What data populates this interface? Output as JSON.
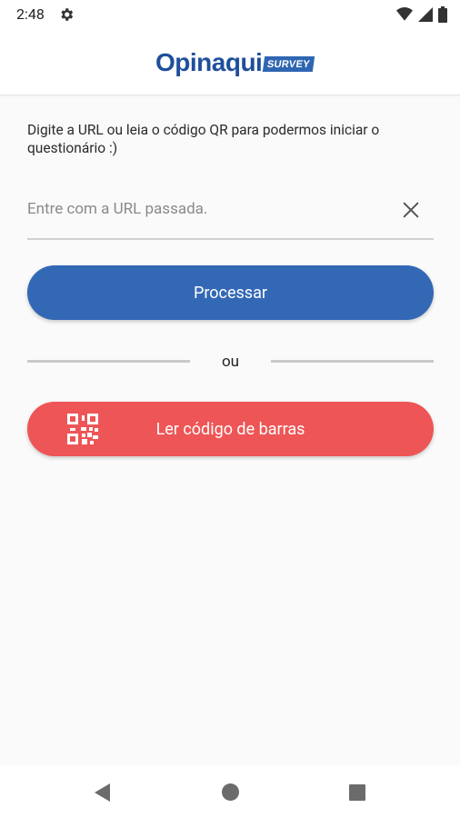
{
  "status_bar": {
    "time": "2:48",
    "icons": [
      "gear-icon",
      "wifi-icon",
      "signal-icon",
      "battery-icon"
    ]
  },
  "header": {
    "logo_text": "Opinaqui",
    "logo_badge": "SURVEY",
    "brand_color": "#1f4f9b"
  },
  "main": {
    "instruction": "Digite a URL ou leia o código QR para podermos iniciar o questionário :)",
    "url_input": {
      "value": "",
      "placeholder": "Entre com a URL passada."
    },
    "process_button": "Processar",
    "divider_text": "ou",
    "scan_button": "Ler código de barras",
    "colors": {
      "process": "#3368b5",
      "scan": "#ee5556"
    }
  },
  "nav_bar": {
    "icons": [
      "back-icon",
      "home-icon",
      "recents-icon"
    ]
  }
}
